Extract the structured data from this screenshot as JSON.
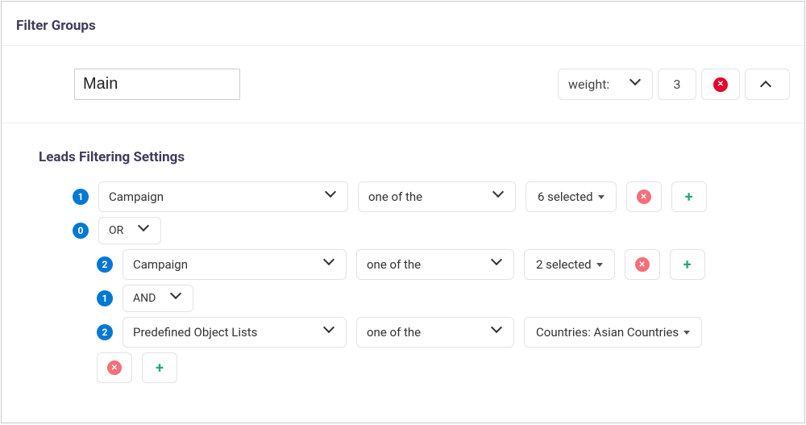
{
  "panel_title": "Filter Groups",
  "group": {
    "name": "Main",
    "weight_label": "weight:",
    "weight_value": "3"
  },
  "section_title": "Leads Filtering Settings",
  "rows": {
    "r1": {
      "badge": "1",
      "field": "Campaign",
      "op": "one of the",
      "val": "6 selected"
    },
    "logic0": {
      "badge": "0",
      "op": "OR"
    },
    "r2": {
      "badge": "2",
      "field": "Campaign",
      "op": "one of the",
      "val": "2 selected"
    },
    "logic1": {
      "badge": "1",
      "op": "AND"
    },
    "r3": {
      "badge": "2",
      "field": "Predefined Object Lists",
      "op": "one of the",
      "val": "Countries: Asian Countries"
    }
  }
}
